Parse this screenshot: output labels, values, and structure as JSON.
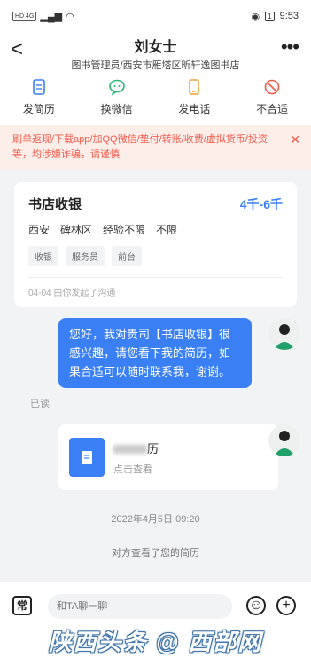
{
  "status_bar": {
    "left": "HD 4G",
    "time": "9:53",
    "battery": "1"
  },
  "header": {
    "back_label": "<",
    "name": "刘女士",
    "subtitle": "图书管理员/西安市雁塔区昕轩逸图书店",
    "more_label": "•••"
  },
  "actions": [
    {
      "label": "发简历",
      "icon": "resume-icon"
    },
    {
      "label": "换微信",
      "icon": "wechat-icon"
    },
    {
      "label": "发电话",
      "icon": "phone-icon"
    },
    {
      "label": "不合适",
      "icon": "not-suitable-icon"
    }
  ],
  "warning": {
    "text": "刷单返现/下载app/加QQ微信/垫付/转账/收费/虚拟货币/投资等，均涉嫌诈骗，请谨慎!",
    "close": "✕"
  },
  "job": {
    "title": "书店收银",
    "salary": "4千-6千",
    "meta": [
      "西安",
      "碑林区",
      "经验不限",
      "不限"
    ],
    "tags": [
      "收银",
      "服务员",
      "前台"
    ],
    "footer": "04-04 由你发起了沟通"
  },
  "message": {
    "text": "您好，我对贵司【书店收银】很感兴趣，请您看下我的简历，如果合适可以随时联系我，谢谢。",
    "read": "已读"
  },
  "file": {
    "name_suffix": "历",
    "sub": "点击查看"
  },
  "timestamp": "2022年4月5日 09:20",
  "system_note": "对方查看了您的简历",
  "input": {
    "chang": "常",
    "placeholder": "和TA聊一聊",
    "emoji": "☺",
    "plus": "+"
  },
  "watermark": "陕西头条 @ 西部网",
  "colors": {
    "accent": "#3b7ff5",
    "warning_bg": "#fdeeea",
    "warning_text": "#f45b4b"
  }
}
